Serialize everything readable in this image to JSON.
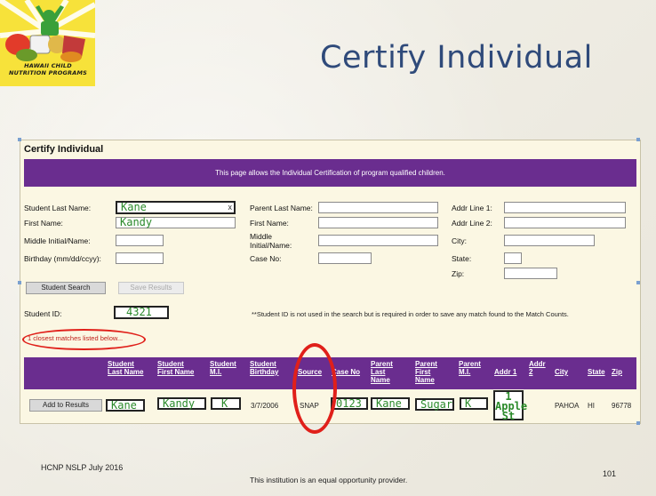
{
  "slide": {
    "title": "Certify Individual",
    "footer_left": "HCNP NSLP July 2016",
    "footer_center": "This institution is an equal opportunity provider.",
    "page_number": "101"
  },
  "logo": {
    "text_line1": "HAWAII CHILD",
    "text_line2": "NUTRITION PROGRAMS"
  },
  "app": {
    "title": "Certify Individual",
    "banner": "This page allows the Individual Certification of program qualified children."
  },
  "student": {
    "last_name_label": "Student Last Name:",
    "last_name_value": "Kane",
    "clear_label": "x",
    "first_name_label": "First Name:",
    "first_name_value": "Kandy",
    "middle_label": "Middle Initial/Name:",
    "middle_value": "",
    "birthday_label": "Birthday (mm/dd/ccyy):",
    "birthday_value": ""
  },
  "parent": {
    "last_name_label": "Parent Last Name:",
    "first_name_label": "First Name:",
    "middle_label_1": "Middle",
    "middle_label_2": "Initial/Name:",
    "case_label": "Case No:"
  },
  "address": {
    "addr1_label": "Addr Line 1:",
    "addr2_label": "Addr Line 2:",
    "city_label": "City:",
    "state_label": "State:",
    "zip_label": "Zip:"
  },
  "buttons": {
    "student_search": "Student Search",
    "save_results": "Save Results",
    "add_to_results": "Add to Results"
  },
  "student_id": {
    "label": "Student ID:",
    "value": "4321",
    "note": "**Student ID is not used in the search but is required in order to save any match found to the Match Counts."
  },
  "matches_text": "1 closest matches listed below...",
  "table": {
    "headers": [
      {
        "l1": "Student",
        "l2": "Last Name",
        "l3": ""
      },
      {
        "l1": "Student",
        "l2": "First Name",
        "l3": ""
      },
      {
        "l1": "Student",
        "l2": "M.I.",
        "l3": ""
      },
      {
        "l1": "Student",
        "l2": "Birthday",
        "l3": ""
      },
      {
        "l1": "Source",
        "l2": "",
        "l3": ""
      },
      {
        "l1": "Case No",
        "l2": "",
        "l3": ""
      },
      {
        "l1": "Parent",
        "l2": "Last",
        "l3": "Name"
      },
      {
        "l1": "Parent",
        "l2": "First",
        "l3": "Name"
      },
      {
        "l1": "Parent",
        "l2": "M.I.",
        "l3": ""
      },
      {
        "l1": "Addr 1",
        "l2": "",
        "l3": ""
      },
      {
        "l1": "Addr",
        "l2": "2",
        "l3": ""
      },
      {
        "l1": "City",
        "l2": "",
        "l3": ""
      },
      {
        "l1": "State",
        "l2": "",
        "l3": ""
      },
      {
        "l1": "Zip",
        "l2": "",
        "l3": ""
      }
    ],
    "row": {
      "last_name": "Kane",
      "first_name": "Kandy",
      "mi": "K",
      "birthday": "3/7/2006",
      "source": "SNAP",
      "case_no": "0123",
      "parent_last": "Kane",
      "parent_first": "Sugar",
      "parent_mi": "K",
      "addr1_l1": "1",
      "addr1_l2": "Apple",
      "addr1_l3": "St",
      "addr2": "",
      "city": "PAHOA",
      "state": "HI",
      "zip": "96778"
    }
  },
  "colors": {
    "banner_purple": "#6a2d8f",
    "title_blue": "#2f4a7a",
    "highlight_red": "#e0201a",
    "entry_green": "#2b8a2b",
    "logo_yellow": "#f7e23a"
  }
}
